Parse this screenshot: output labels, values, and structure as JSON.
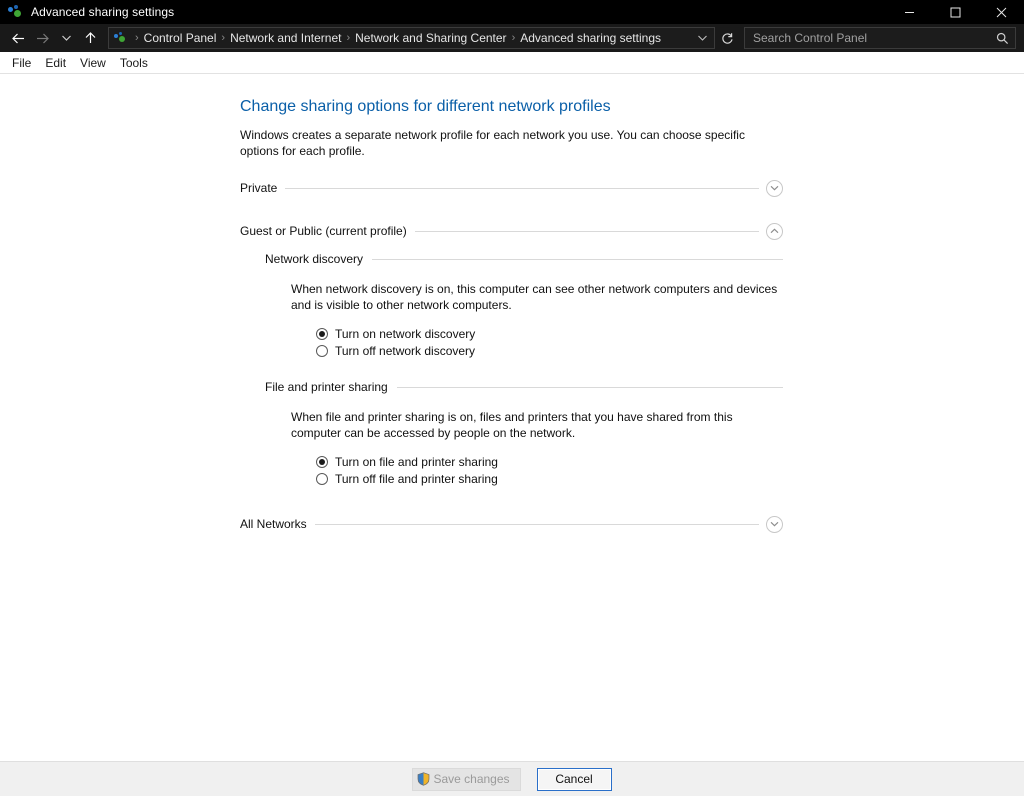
{
  "window": {
    "title": "Advanced sharing settings",
    "icon": "network-sharing-icon",
    "minimize_label": "Minimize",
    "maximize_label": "Maximize",
    "close_label": "Close"
  },
  "address_bar": {
    "back_label": "Back",
    "forward_label": "Forward",
    "recent_label": "Recent locations",
    "up_label": "Up one level",
    "breadcrumbs": [
      "Control Panel",
      "Network and Internet",
      "Network and Sharing Center",
      "Advanced sharing settings"
    ],
    "separator": "›",
    "refresh_label": "Refresh",
    "dropdown_label": "Previous locations"
  },
  "search": {
    "placeholder": "Search Control Panel",
    "value": ""
  },
  "menubar": {
    "items": [
      "File",
      "Edit",
      "View",
      "Tools"
    ]
  },
  "main": {
    "title": "Change sharing options for different network profiles",
    "description": "Windows creates a separate network profile for each network you use. You can choose specific options for each profile.",
    "profiles": [
      {
        "label": "Private",
        "expanded": false,
        "chevron": "chevron-down-icon"
      },
      {
        "label": "Guest or Public (current profile)",
        "expanded": true,
        "chevron": "chevron-up-icon"
      },
      {
        "label": "All Networks",
        "expanded": false,
        "chevron": "chevron-down-icon"
      }
    ],
    "sections": [
      {
        "title": "Network discovery",
        "description": "When network discovery is on, this computer can see other network computers and devices and is visible to other network computers.",
        "options": [
          {
            "label": "Turn on network discovery",
            "selected": true
          },
          {
            "label": "Turn off network discovery",
            "selected": false
          }
        ]
      },
      {
        "title": "File and printer sharing",
        "description": "When file and printer sharing is on, files and printers that you have shared from this computer can be accessed by people on the network.",
        "options": [
          {
            "label": "Turn on file and printer sharing",
            "selected": true
          },
          {
            "label": "Turn off file and printer sharing",
            "selected": false
          }
        ]
      }
    ]
  },
  "footer": {
    "save_label": "Save changes",
    "save_enabled": false,
    "save_icon": "uac-shield-icon",
    "cancel_label": "Cancel"
  },
  "colors": {
    "title_link": "#0a5fa8",
    "titlebar_bg": "#000000",
    "addressbar_bg": "#191919",
    "content_bg": "#ffffff",
    "footer_bg": "#f0f0f0",
    "focus_border": "#2a6fc9",
    "rule": "#d9d9d9"
  }
}
